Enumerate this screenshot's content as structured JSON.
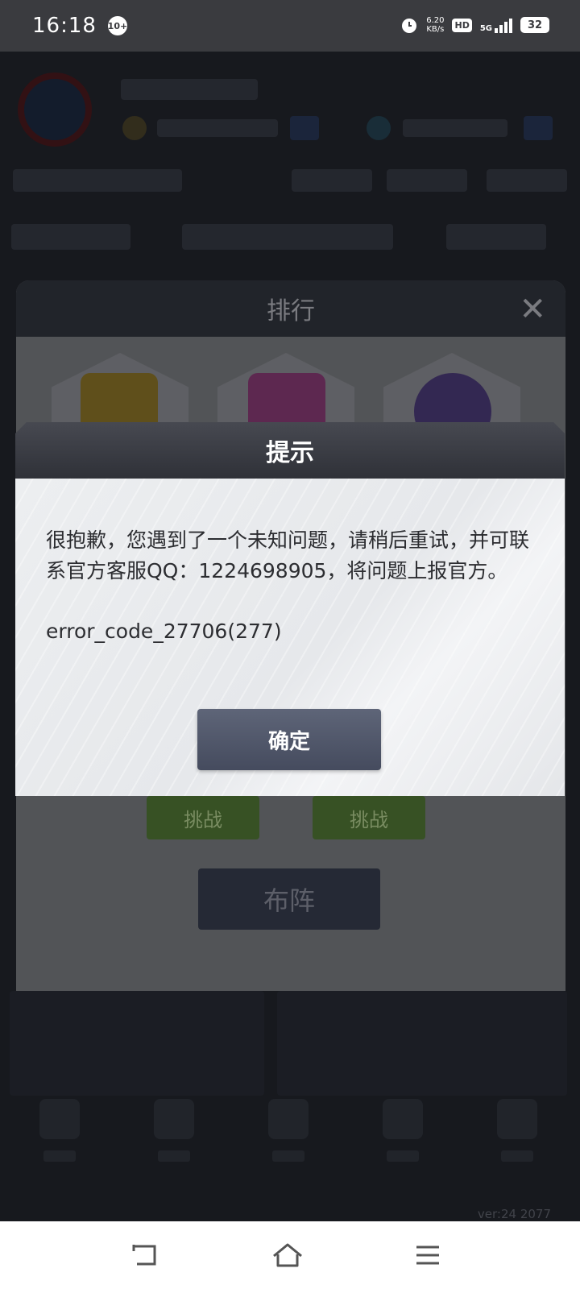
{
  "status_bar": {
    "time": "16:18",
    "notification_badge": "10+",
    "net_speed_value": "6.20",
    "net_speed_unit": "KB/s",
    "hd_label": "HD",
    "network_label": "5G",
    "battery": "32"
  },
  "ranking_panel": {
    "title": "排行",
    "challenge_label_1": "挑战",
    "challenge_label_2": "挑战",
    "formation_label": "布阵"
  },
  "dialog": {
    "title": "提示",
    "message": "很抱歉，您遇到了一个未知问题，请稍后重试，并可联系官方客服QQ：1224698905，将问题上报官方。",
    "error_code": "error_code_27706(277)",
    "confirm_label": "确定"
  },
  "footer": {
    "version": "ver:24  2077"
  },
  "colors": {
    "accent_button": "#4d5366",
    "challenge_green": "#3f5d2a"
  }
}
